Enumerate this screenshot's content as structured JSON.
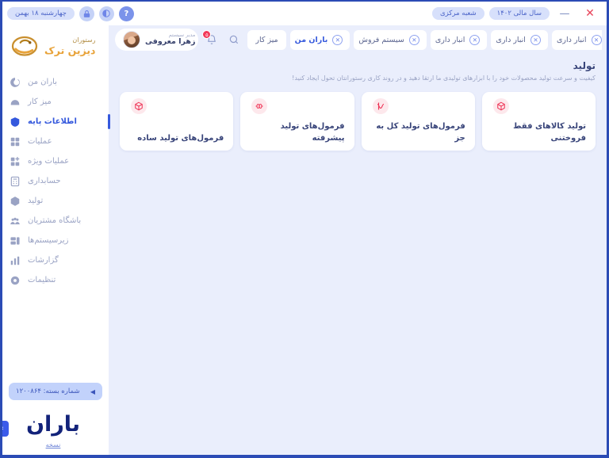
{
  "titlebar": {
    "date_badge": "چهارشنبه ۱۸ بهمن",
    "lock_icon": "lock-icon",
    "theme_icon": "theme-toggle-icon",
    "help_icon": "help-icon",
    "branch_badge": "شعبه مرکزی",
    "fiscal_year_badge": "سال مالی ۱۴۰۲",
    "minimize_label": "—",
    "close_label": "✕"
  },
  "sidebar": {
    "brand": {
      "top": "رستوران",
      "name": "دیزین ترک"
    },
    "items": [
      {
        "label": "باران من",
        "icon": "baran-icon",
        "active": false
      },
      {
        "label": "میز کار",
        "icon": "desk-icon",
        "active": false
      },
      {
        "label": "اطلاعات پایه",
        "icon": "database-icon",
        "active": true
      },
      {
        "label": "عملیات",
        "icon": "grid-icon",
        "active": false
      },
      {
        "label": "عملیات ویژه",
        "icon": "grid-plus-icon",
        "active": false
      },
      {
        "label": "حسابداری",
        "icon": "calculator-icon",
        "active": false
      },
      {
        "label": "تولید",
        "icon": "box-icon",
        "active": false
      },
      {
        "label": "باشگاه مشتریان",
        "icon": "users-icon",
        "active": false
      },
      {
        "label": "زیرسیستم‌ها",
        "icon": "subsystems-icon",
        "active": false
      },
      {
        "label": "گزارشات",
        "icon": "chart-bar-icon",
        "active": false
      },
      {
        "label": "تنظیمات",
        "icon": "gear-icon",
        "active": false
      }
    ],
    "package": {
      "label": "شماره بسته: ۱۲۰۰۸۶۴",
      "arrow": "◀"
    },
    "footer": {
      "logo_text": "باران",
      "version_link": "نسخه",
      "collapse_arrow": "›"
    }
  },
  "topbar": {
    "user": {
      "role": "مدیر سیستم",
      "name": "زهرا معروفی",
      "avatar": "avatar"
    },
    "notifications": {
      "icon": "bell-icon",
      "count": "۵"
    },
    "search": {
      "icon": "search-icon"
    },
    "tabs": [
      {
        "label": "میز کار",
        "closable": false,
        "active": false
      },
      {
        "label": "باران من",
        "closable": true,
        "active": true
      },
      {
        "label": "سیستم فروش",
        "closable": true,
        "active": false
      },
      {
        "label": "انبار داری",
        "closable": true,
        "active": false
      },
      {
        "label": "انبار داری",
        "closable": true,
        "active": false
      },
      {
        "label": "انبار داری",
        "closable": true,
        "active": false
      }
    ],
    "tab_close_label": "✕"
  },
  "content": {
    "title": "تولید",
    "subtitle": "کیفیت و سرعت تولید محصولات خود را با ابزارهای تولیدی ما ارتقا دهید و در روند کاری رستورانتان تحول ایجاد کنید!",
    "cards": [
      {
        "title": "فرمول‌های تولید ساده",
        "icon": "formula-simple-icon"
      },
      {
        "title": "فرمول‌های تولید پیشرفته",
        "icon": "formula-advanced-icon"
      },
      {
        "title": "فرمول‌های تولید کل به جز",
        "icon": "formula-except-icon"
      },
      {
        "title": "تولید کالاهای فقط فروختنی",
        "icon": "sellable-goods-icon"
      }
    ]
  },
  "colors": {
    "accent_blue": "#3559dd",
    "accent_red": "#ee1f3f",
    "brand_gold": "#e8a33a",
    "bg": "#eaeefc"
  }
}
